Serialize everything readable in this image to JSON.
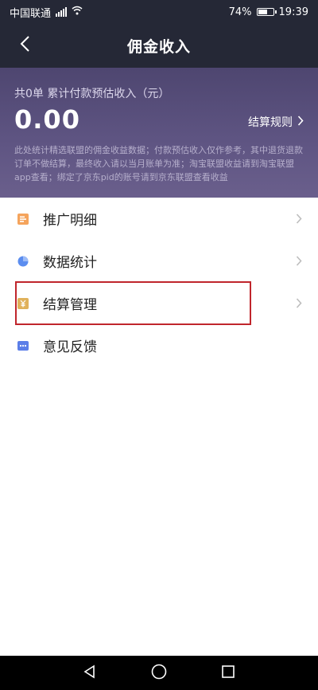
{
  "status_bar": {
    "carrier": "中国联通",
    "network": "4G",
    "battery": "74%",
    "battery_level": 0.74,
    "time": "19:39"
  },
  "nav": {
    "title": "佣金收入"
  },
  "summary": {
    "label": "共0单 累计付款预估收入（元）",
    "amount": "0.00",
    "rules_link": "结算规则",
    "note": "此处统计精选联盟的佣金收益数据；付款预估收入仅作参考，其中退货退款订单不做结算，最终收入请以当月账单为准；淘宝联盟收益请到淘宝联盟app查看；绑定了京东pid的账号请到京东联盟查看收益"
  },
  "menu": {
    "items": [
      {
        "label": "推广明细",
        "icon": "promotion-detail-icon",
        "color": "#f5a45c"
      },
      {
        "label": "数据统计",
        "icon": "pie-chart-icon",
        "color": "#5b8def"
      },
      {
        "label": "结算管理",
        "icon": "settlement-icon",
        "color": "#e0b15a"
      },
      {
        "label": "意见反馈",
        "icon": "feedback-icon",
        "color": "#5b7ee8"
      }
    ]
  },
  "colors": {
    "header_bg": "#252836",
    "summary_gradient_top": "#4e4670",
    "summary_gradient_bottom": "#6a5f8c",
    "highlight": "#c0262c"
  }
}
